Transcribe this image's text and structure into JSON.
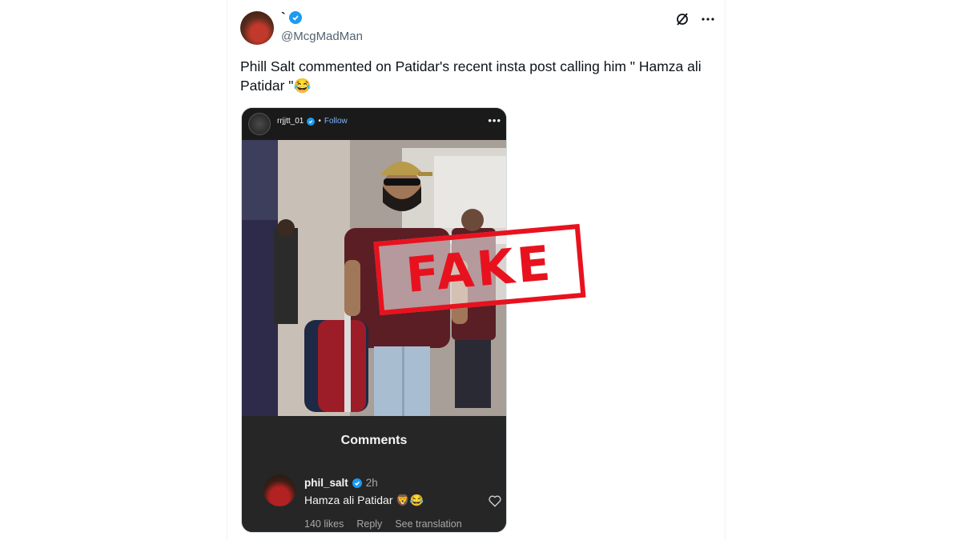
{
  "tweet": {
    "display_name": "`",
    "handle": "@McgMadMan",
    "text": "Phill Salt commented on Patidar's recent insta post calling him \" Hamza ali Patidar \"😂",
    "icons": [
      "grok-icon",
      "more-icon"
    ]
  },
  "media": {
    "instagram_header": {
      "username": "rrjjtt_01",
      "separator": "•",
      "follow_label": "Follow"
    },
    "comments_title": "Comments",
    "comment": {
      "username": "phil_salt",
      "time": "2h",
      "text": "Hamza ali Patidar 🦁😂",
      "likes": "140 likes",
      "reply_label": "Reply",
      "translation_label": "See translation"
    }
  },
  "stamp": {
    "text": "FAKE",
    "color": "#e8121f"
  },
  "colors": {
    "verified": "#1d9bf0",
    "secondary_text": "#536471",
    "instagram_bg": "#262626"
  }
}
